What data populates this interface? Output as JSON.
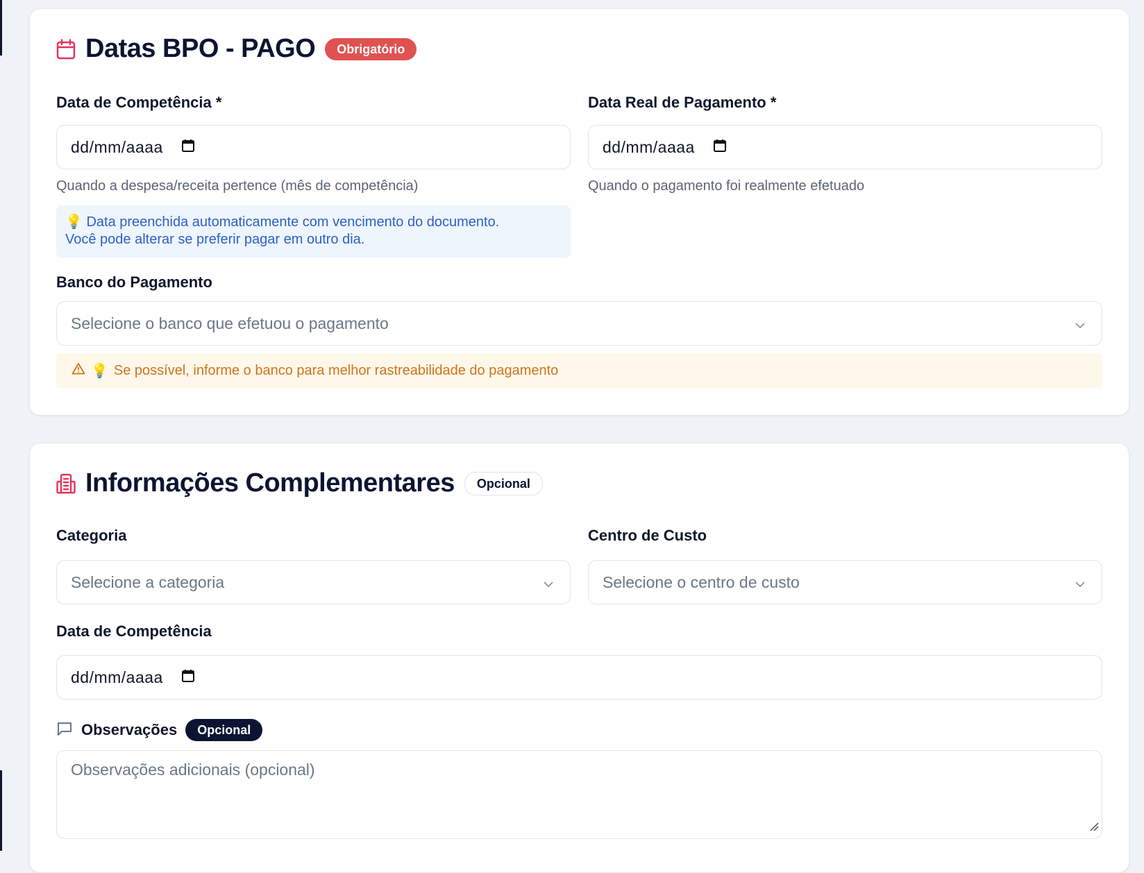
{
  "section_bpo": {
    "title": "Datas BPO - PAGO",
    "badge": "Obrigatório",
    "competencia": {
      "label": "Data de Competência *",
      "value": "dd/mm/aaaa",
      "help": "Quando a despesa/receita pertence (mês de competência)",
      "info_line1": "Data preenchida automaticamente com vencimento do documento.",
      "info_line2": "Você pode alterar se preferir pagar em outro dia."
    },
    "pagamento": {
      "label": "Data Real de Pagamento *",
      "value": "dd/mm/aaaa",
      "help": "Quando o pagamento foi realmente efetuado"
    },
    "banco": {
      "label": "Banco do Pagamento",
      "placeholder": "Selecione o banco que efetuou o pagamento",
      "warning": "Se possível, informe o banco para melhor rastreabilidade do pagamento"
    }
  },
  "section_info": {
    "title": "Informações Complementares",
    "badge": "Opcional",
    "categoria": {
      "label": "Categoria",
      "placeholder": "Selecione a categoria"
    },
    "centro_custo": {
      "label": "Centro de Custo",
      "placeholder": "Selecione o centro de custo"
    },
    "competencia": {
      "label": "Data de Competência",
      "value": "dd/mm/aaaa"
    },
    "observacoes": {
      "label": "Observações",
      "badge": "Opcional",
      "placeholder": "Observações adicionais (opcional)"
    }
  },
  "icons": {
    "section_bpo": "calendar-icon",
    "section_info": "building-icon",
    "date_picker": "calendar-icon",
    "select": "chevron-down-icon",
    "info": "lightbulb-icon",
    "warning": "warning-triangle-icon",
    "observacoes": "message-square-icon"
  },
  "colors": {
    "accent": "#e0335a",
    "required_badge": "#e05252",
    "info_text": "#2e5fc7",
    "warning_text": "#d0741c",
    "dark": "#0b1533"
  }
}
